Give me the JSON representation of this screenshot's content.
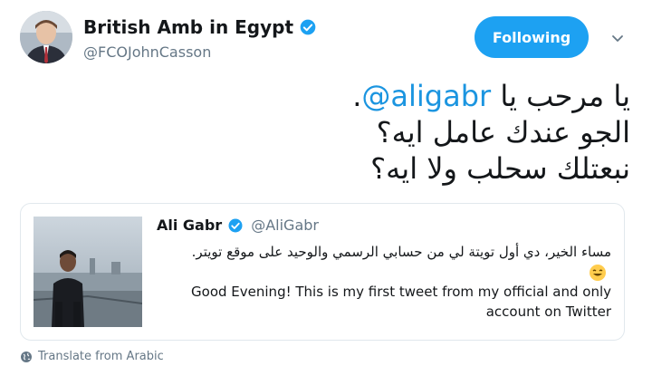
{
  "author": {
    "display_name": "British Amb in Egypt",
    "handle": "@FCOJohnCasson",
    "verified": true
  },
  "follow_button": {
    "label": "Following"
  },
  "tweet": {
    "line1_prefix": "يا مرحب يا ",
    "line1_mention": "@aligabr",
    "line1_suffix": ".",
    "line2": "الجو عندك عامل ايه؟",
    "line3": "نبعتلك سحلب ولا ايه؟"
  },
  "quoted_tweet": {
    "display_name": "Ali Gabr",
    "handle": "@AliGabr",
    "verified": true,
    "text_arabic": "مساء الخير، دي أول تويتة لي من حسابي الرسمي والوحيد على موقع تويتر.",
    "text_english": "Good Evening! This is my first tweet from my official and only account on Twitter"
  },
  "translate": {
    "label": "Translate from Arabic",
    "icon": "globe-icon"
  },
  "colors": {
    "accent": "#1da1f2",
    "mention": "#1b95e0",
    "muted": "#657786"
  }
}
